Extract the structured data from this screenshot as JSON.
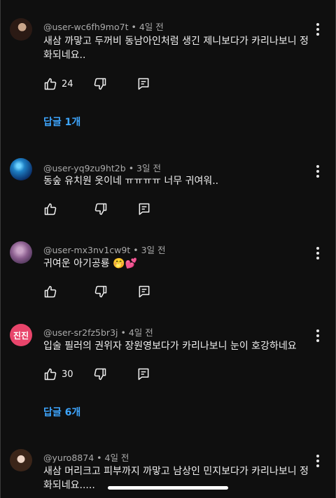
{
  "comments": [
    {
      "user": "@user-wc6fh9mo7t",
      "time": "4일 전",
      "text": "새삼 까맣고 두꺼비 동남아인처럼 생긴 제니보다가 카리나보니 정화되네요..",
      "likes": "24",
      "replies": "답글 1개"
    },
    {
      "user": "@user-yq9zu9ht2b",
      "time": "3일 전",
      "text": "동숲 유치원 옷이네 ㅠㅠㅠㅠ 너무 귀여워..",
      "likes": "",
      "replies": ""
    },
    {
      "user": "@user-mx3nv1cw9t",
      "time": "3일 전",
      "text": "귀여운 아기공룡 🤭💕",
      "likes": "",
      "replies": ""
    },
    {
      "user": "@user-sr2fz5br3j",
      "time": "4일 전",
      "avatar_text": "진진",
      "text": "입술 필러의 권위자 장원영보다가 카리나보니 눈이 호강하네요",
      "likes": "30",
      "replies": "답글 6개"
    },
    {
      "user": "@yuro8874",
      "time": "4일 전",
      "text": "새삼 머리크고 피부까지 까맣고 남상인 민지보다가 카리나보니 정화되네요.....",
      "likes": "",
      "replies": ""
    }
  ],
  "separator": "•",
  "colors": {
    "background": "#0f0f0f",
    "link": "#3ea6ff",
    "meta": "#aaaaaa"
  }
}
